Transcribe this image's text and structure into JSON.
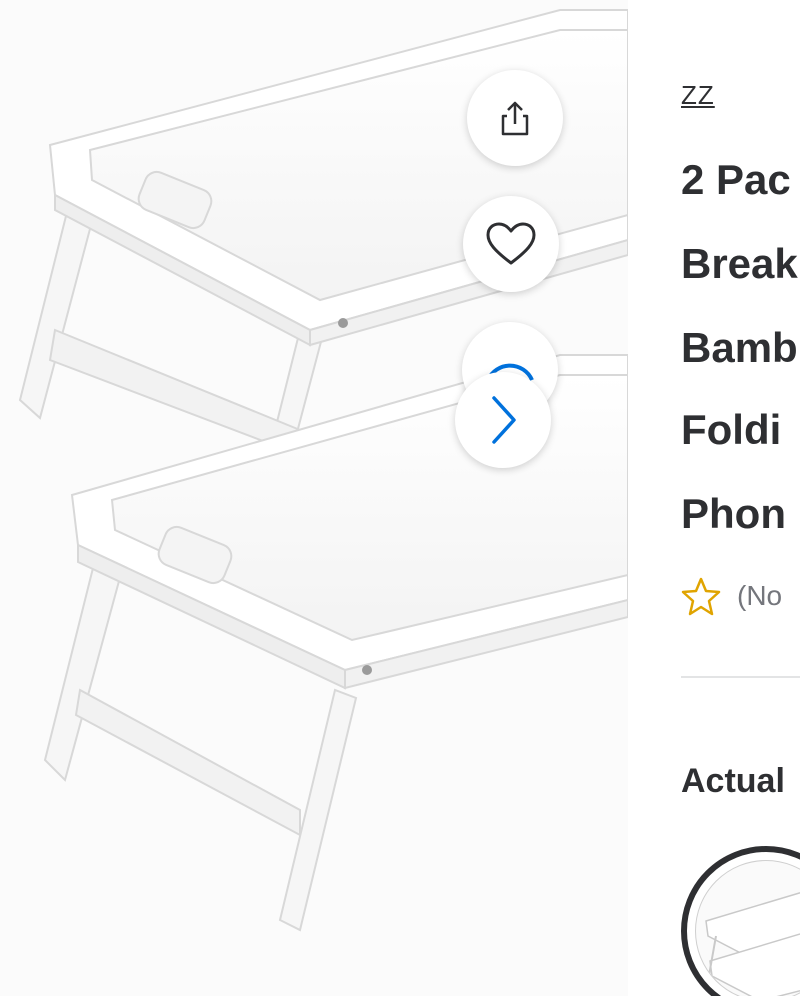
{
  "product": {
    "brand": "ZZ",
    "title_lines": [
      "2 Pac",
      "Break",
      "Bamb",
      "Foldi",
      "Phon"
    ]
  },
  "rating": {
    "text": "(No"
  },
  "variant": {
    "section_label": "Actual"
  },
  "icons": {
    "share": "share-icon",
    "favorite": "heart-icon",
    "next": "chevron-right-icon",
    "rating": "star-outline-icon"
  },
  "colors": {
    "text": "#2e2f32",
    "muted": "#74767c",
    "accent_blue": "#0071dc",
    "star": "#e0a400"
  }
}
